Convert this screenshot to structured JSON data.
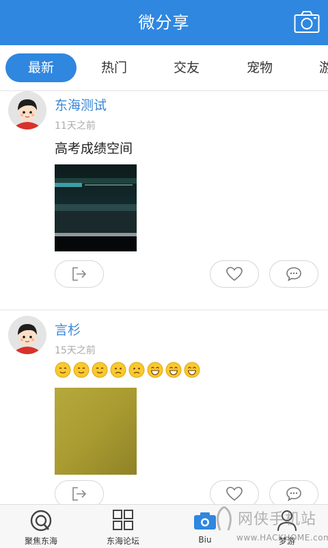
{
  "header": {
    "title": "微分享",
    "camera_icon": "camera-icon"
  },
  "tabs": [
    {
      "label": "最新",
      "active": true
    },
    {
      "label": "热门",
      "active": false
    },
    {
      "label": "交友",
      "active": false
    },
    {
      "label": "宠物",
      "active": false
    },
    {
      "label": "游",
      "active": false
    }
  ],
  "posts": [
    {
      "username": "东海测试",
      "time": "11天之前",
      "content": "高考成绩空间",
      "actions": [
        "share-icon",
        "heart-icon",
        "comment-icon"
      ]
    },
    {
      "username": "言杉",
      "time": "15天之前",
      "emojis": [
        "smile",
        "smile",
        "smile",
        "sad",
        "sad",
        "grin",
        "grin",
        "grin"
      ],
      "actions": [
        "share-icon",
        "heart-icon",
        "comment-icon"
      ]
    }
  ],
  "bottom_nav": [
    {
      "label": "聚焦东海",
      "icon": "focus-icon"
    },
    {
      "label": "东海论坛",
      "icon": "grid-icon"
    },
    {
      "label": "Biu",
      "icon": "camera-icon"
    },
    {
      "label": "梦游",
      "icon": "person-icon"
    }
  ],
  "watermark": {
    "brand": "网侠手机站",
    "url": "www.HACKHOME.com"
  },
  "colors": {
    "primary": "#2f87e0",
    "username": "#3a86d4"
  }
}
